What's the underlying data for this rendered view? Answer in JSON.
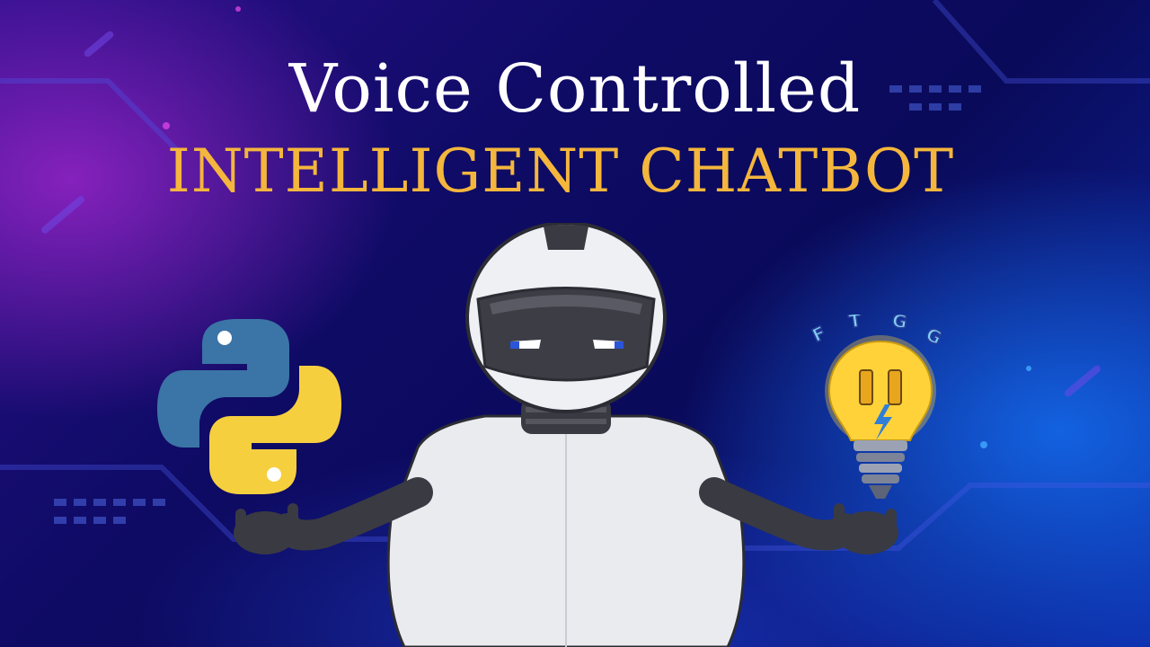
{
  "title": {
    "line1": "Voice Controlled",
    "line2": "INTELLIGENT CHATBOT"
  },
  "logo": {
    "letters": [
      "F",
      "T",
      "G",
      "G"
    ]
  },
  "icons": {
    "left": "python-logo-icon",
    "center": "robot-illustration",
    "right": "lightbulb-logo-icon"
  },
  "colors": {
    "title_white": "#ffffff",
    "title_gold": "#f4b63c",
    "python_blue": "#3b74a6",
    "python_yellow": "#f6cf3f",
    "bulb_yellow": "#ffd23a"
  }
}
